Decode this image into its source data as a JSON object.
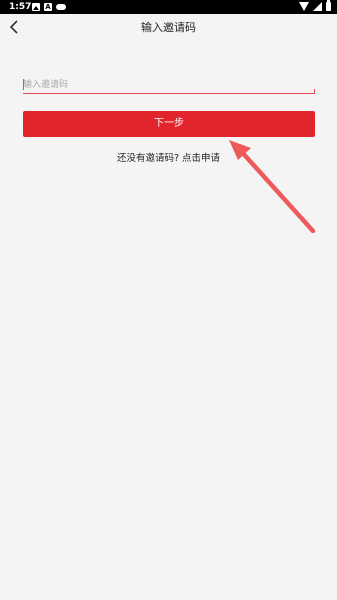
{
  "status_bar": {
    "time": "1:57",
    "notification_icons": [
      "image-icon",
      "a-icon",
      "gamepad-icon"
    ],
    "system_icons": [
      "wifi-icon",
      "signal-icon",
      "battery-icon"
    ]
  },
  "header": {
    "title": "输入邀请码"
  },
  "form": {
    "code_placeholder": "输入邀请码",
    "code_value": "",
    "next_button_label": "下一步"
  },
  "apply": {
    "prompt": "还没有邀请码?",
    "link_label": "点击申请"
  },
  "colors": {
    "accent": "#e2242c",
    "arrow": "#ee5a5a",
    "background": "#f4f4f4"
  }
}
